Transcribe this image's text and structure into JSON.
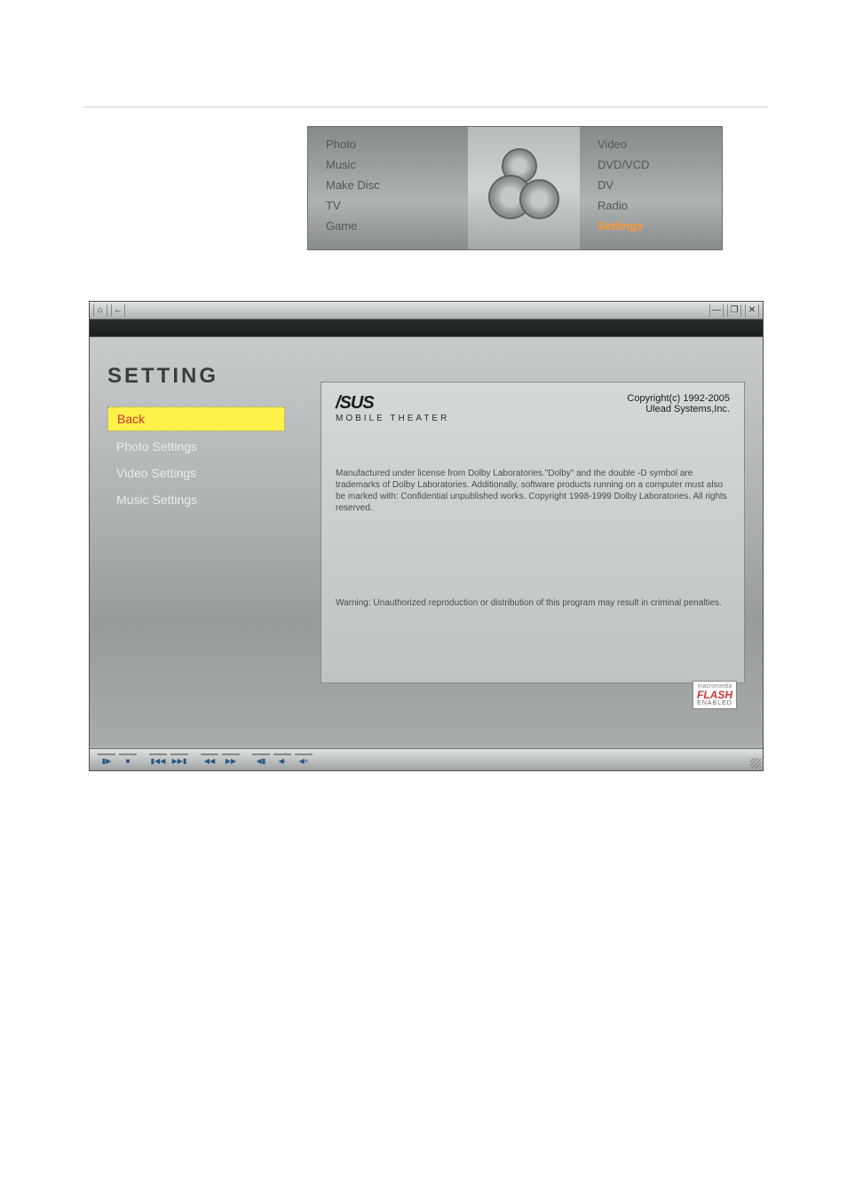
{
  "topMenu": {
    "left": [
      "Photo",
      "Music",
      "Make Disc",
      "TV",
      "Game"
    ],
    "right": [
      "Video",
      "DVD/VCD",
      "DV",
      "Radio",
      "Settings"
    ]
  },
  "settingsWindow": {
    "title": "SETTING",
    "sidebar": [
      "Back",
      "Photo Settings",
      "Video Settings",
      "Music Settings"
    ],
    "brand": "/SUS",
    "brandSub": "MOBILE THEATER",
    "copyright1": "Copyright(c) 1992-2005",
    "copyright2": "Ulead Systems,Inc.",
    "license": "Manufactured under license from Dolby Laboratories.\"Dolby\" and the double -D symbol are trademarks of Dolby Laboratories. Additionally, software products running on a computer must also be marked with: Confidential unpublished works. Copyright 1998-1999 Dolby Laboratories. All rights reserved.",
    "warning": "Warning: Unauthorized reproduction or distribution of this program may result in criminal penalties.",
    "flash": {
      "macro": "macromedia",
      "main": "FLASH",
      "enabled": "ENABLED"
    }
  }
}
